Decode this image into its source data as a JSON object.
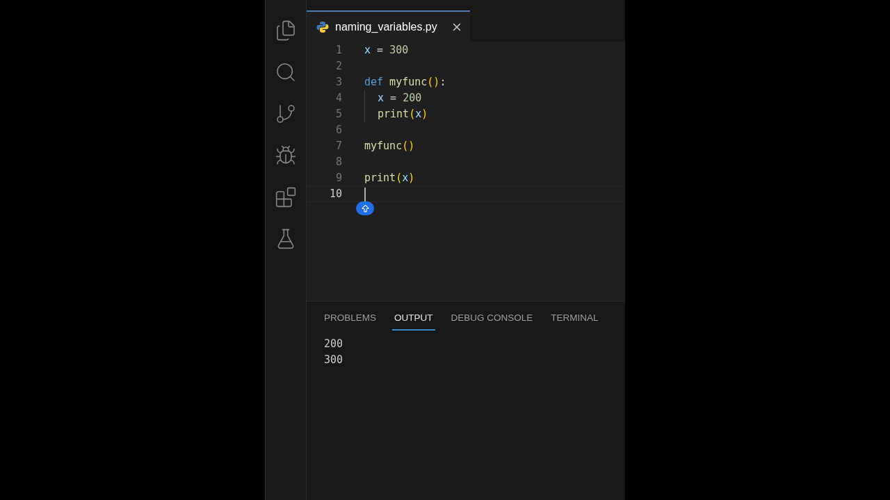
{
  "activity_bar": {
    "items": [
      {
        "kind": "files",
        "selected": false
      },
      {
        "kind": "search",
        "selected": false
      },
      {
        "kind": "source-control",
        "selected": false
      },
      {
        "kind": "run-debug",
        "selected": false
      },
      {
        "kind": "extensions",
        "selected": false
      },
      {
        "kind": "testing",
        "selected": false
      }
    ]
  },
  "tabs": [
    {
      "label": "naming_variables.py",
      "selected": true
    }
  ],
  "editor": {
    "lines": [
      {
        "number": "1",
        "current": false,
        "indent": false,
        "tokens": [
          {
            "text": "x",
            "kind": "variable"
          },
          {
            "text": " = ",
            "kind": "plain"
          },
          {
            "text": "300",
            "kind": "number"
          }
        ]
      },
      {
        "number": "2",
        "current": false,
        "indent": false
      },
      {
        "number": "3",
        "current": false,
        "indent": false,
        "tokens": [
          {
            "text": "def",
            "kind": "keyword"
          },
          {
            "text": " myfunc",
            "kind": "function"
          },
          {
            "text": "()",
            "kind": "bracket"
          },
          {
            "text": ":",
            "kind": "plain"
          }
        ]
      },
      {
        "number": "4",
        "current": false,
        "indent": true,
        "tokens": [
          {
            "text": "x",
            "kind": "variable"
          },
          {
            "text": " = ",
            "kind": "plain"
          },
          {
            "text": "200",
            "kind": "number"
          }
        ]
      },
      {
        "number": "5",
        "current": false,
        "indent": true,
        "tokens": [
          {
            "text": "print",
            "kind": "function"
          },
          {
            "text": "(",
            "kind": "bracket"
          },
          {
            "text": "x",
            "kind": "variable"
          },
          {
            "text": ")",
            "kind": "bracket"
          }
        ]
      },
      {
        "number": "6",
        "current": false,
        "indent": false
      },
      {
        "number": "7",
        "current": false,
        "indent": false,
        "tokens": [
          {
            "text": "myfunc",
            "kind": "function"
          },
          {
            "text": "()",
            "kind": "bracket"
          }
        ]
      },
      {
        "number": "8",
        "current": false,
        "indent": false
      },
      {
        "number": "9",
        "current": false,
        "indent": false,
        "tokens": [
          {
            "text": "print",
            "kind": "function"
          },
          {
            "text": "(",
            "kind": "bracket"
          },
          {
            "text": "x",
            "kind": "variable"
          },
          {
            "text": ")",
            "kind": "bracket"
          }
        ]
      },
      {
        "number": "10",
        "current": true,
        "indent": false
      }
    ]
  },
  "panel": {
    "tabs": [
      {
        "label": "PROBLEMS",
        "selected": false
      },
      {
        "label": "OUTPUT",
        "selected": true
      },
      {
        "label": "DEBUG CONSOLE",
        "selected": false
      },
      {
        "label": "TERMINAL",
        "selected": false
      }
    ],
    "output": [
      "200",
      "300"
    ]
  }
}
